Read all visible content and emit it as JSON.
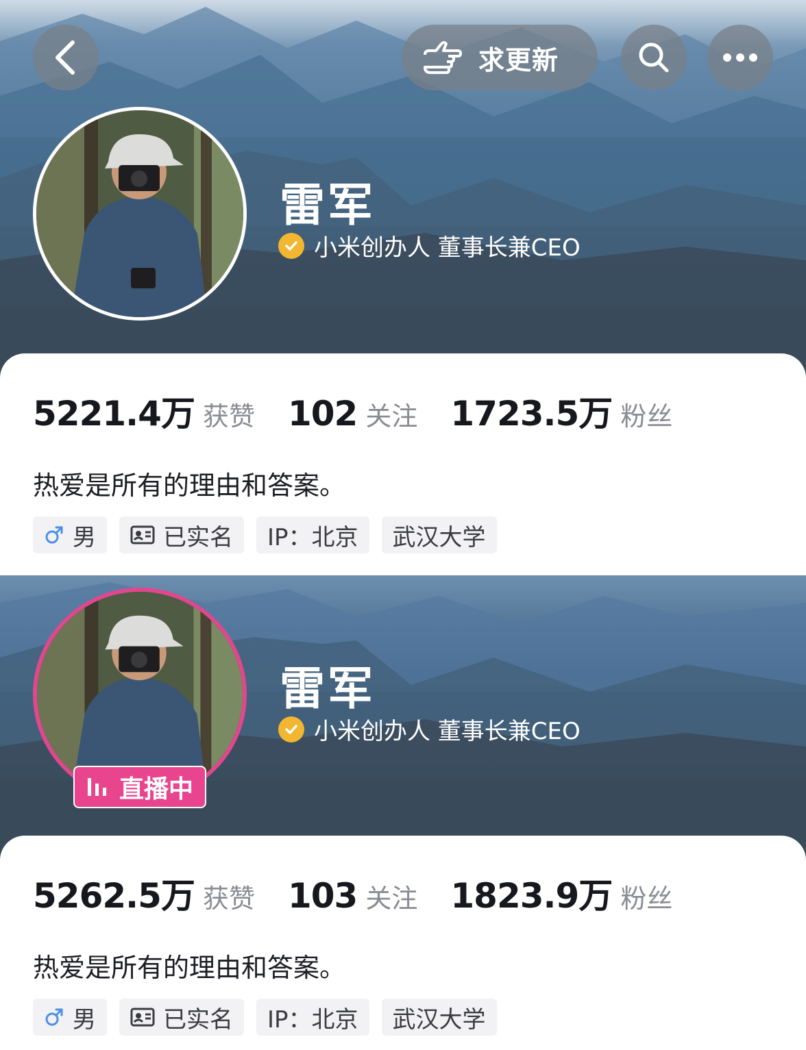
{
  "header": {
    "update_label": "求更新"
  },
  "profiles": [
    {
      "name": "雷军",
      "verified_title": "小米创办人 董事长兼CEO",
      "stats": [
        {
          "value": "5221.4万",
          "label": "获赞"
        },
        {
          "value": "102",
          "label": "关注"
        },
        {
          "value": "1723.5万",
          "label": "粉丝"
        }
      ],
      "bio": "热爱是所有的理由和答案。",
      "tags": [
        "男",
        "已实名",
        "IP：北京",
        "武汉大学"
      ]
    },
    {
      "name": "雷军",
      "verified_title": "小米创办人 董事长兼CEO",
      "live_label": "直播中",
      "stats": [
        {
          "value": "5262.5万",
          "label": "获赞"
        },
        {
          "value": "103",
          "label": "关注"
        },
        {
          "value": "1823.9万",
          "label": "粉丝"
        }
      ],
      "bio": "热爱是所有的理由和答案。",
      "tags": [
        "男",
        "已实名",
        "IP：北京",
        "武汉大学"
      ]
    }
  ],
  "icons": {
    "back": "chevron-left-icon",
    "update": "pointing-hand-icon",
    "search": "search-icon",
    "more": "more-dots-icon",
    "verified": "check-badge-icon",
    "gender": "male-icon",
    "id_card": "id-card-icon",
    "live": "live-bars-icon"
  },
  "colors": {
    "verified_badge": "#f2b630",
    "live_accent": "#e8458e",
    "male_icon": "#4a8fe7"
  }
}
